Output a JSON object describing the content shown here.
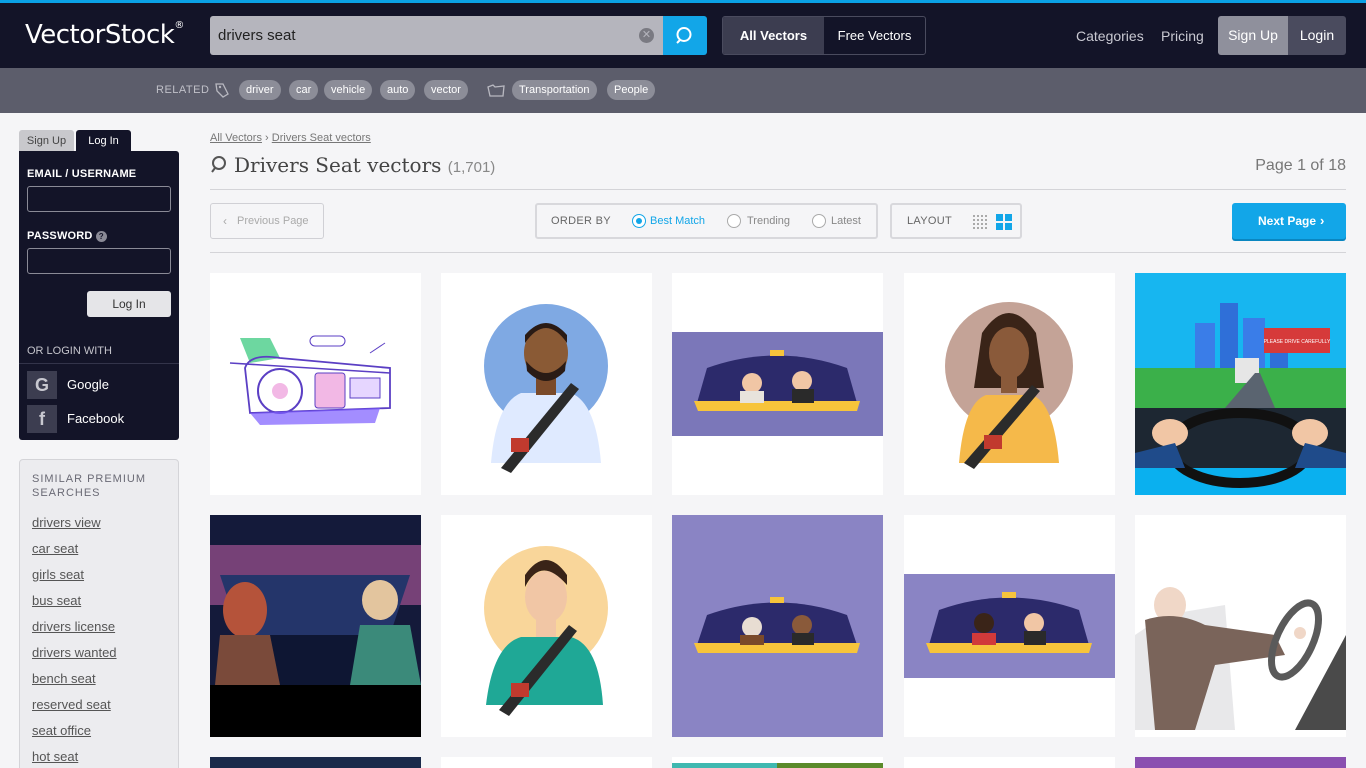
{
  "header": {
    "logo": "VectorStock",
    "logo_mark": "®",
    "search_value": "drivers seat",
    "toggle_all": "All Vectors",
    "toggle_free": "Free Vectors",
    "nav_categories": "Categories",
    "nav_pricing": "Pricing",
    "signup": "Sign Up",
    "login": "Login",
    "accent_color": "#12a6e8"
  },
  "related": {
    "label": "RELATED",
    "tags": [
      "driver",
      "car",
      "vehicle",
      "auto",
      "vector"
    ],
    "categories": [
      "Transportation",
      "People"
    ]
  },
  "login_panel": {
    "tab_signup": "Sign Up",
    "tab_login": "Log In",
    "email_label": "EMAIL / USERNAME",
    "password_label": "PASSWORD",
    "password_help": "?",
    "submit": "Log In",
    "or_login_with": "OR LOGIN WITH",
    "google": "Google",
    "facebook": "Facebook"
  },
  "similar": {
    "title": "SIMILAR PREMIUM SEARCHES",
    "links": [
      "drivers view",
      "car seat",
      "girls seat",
      "bus seat",
      "drivers license",
      "drivers wanted",
      "bench seat",
      "reserved seat",
      "seat office",
      "hot seat"
    ]
  },
  "main": {
    "breadcrumb": [
      "All Vectors",
      "Drivers Seat vectors"
    ],
    "breadcrumb_sep": "›",
    "title": "Drivers Seat vectors",
    "count": "(1,701)",
    "page_info": "Page 1 of 18",
    "prev": "Previous Page",
    "next": "Next Page",
    "order_by": "ORDER BY",
    "order_options": [
      "Best Match",
      "Trending",
      "Latest"
    ],
    "order_selected": "Best Match",
    "layout": "LAYOUT",
    "billboard_text": "PLEASE DRIVE CAREFULLY"
  }
}
